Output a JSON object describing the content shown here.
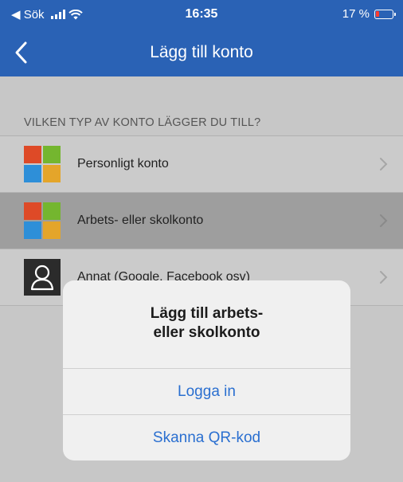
{
  "status_bar": {
    "back_app": "◀ Sök",
    "time": "16:35",
    "battery": "17 %",
    "battery_level": 0.17,
    "battery_color": "#ff3b30"
  },
  "nav": {
    "title": "Lägg till konto",
    "back_icon": "chevron-left-icon",
    "bar_color": "#2a62b5"
  },
  "section_header": "VILKEN TYP AV KONTO LÄGGER DU TILL?",
  "accounts": [
    {
      "label": "Personligt konto",
      "icon": "microsoft-logo-icon"
    },
    {
      "label": "Arbets- eller skolkonto",
      "icon": "microsoft-logo-icon",
      "selected": true
    },
    {
      "label": "Annat (Google, Facebook osv)",
      "icon": "person-icon"
    }
  ],
  "sheet": {
    "title_line1": "Lägg till arbets-",
    "title_line2": "eller skolkonto",
    "sign_in": "Logga in",
    "scan_qr": "Skanna QR-kod",
    "action_color": "#2a6fd0"
  },
  "ms_logo_colors": [
    "#de4a27",
    "#74b62f",
    "#2e8fd8",
    "#e4a52a"
  ]
}
